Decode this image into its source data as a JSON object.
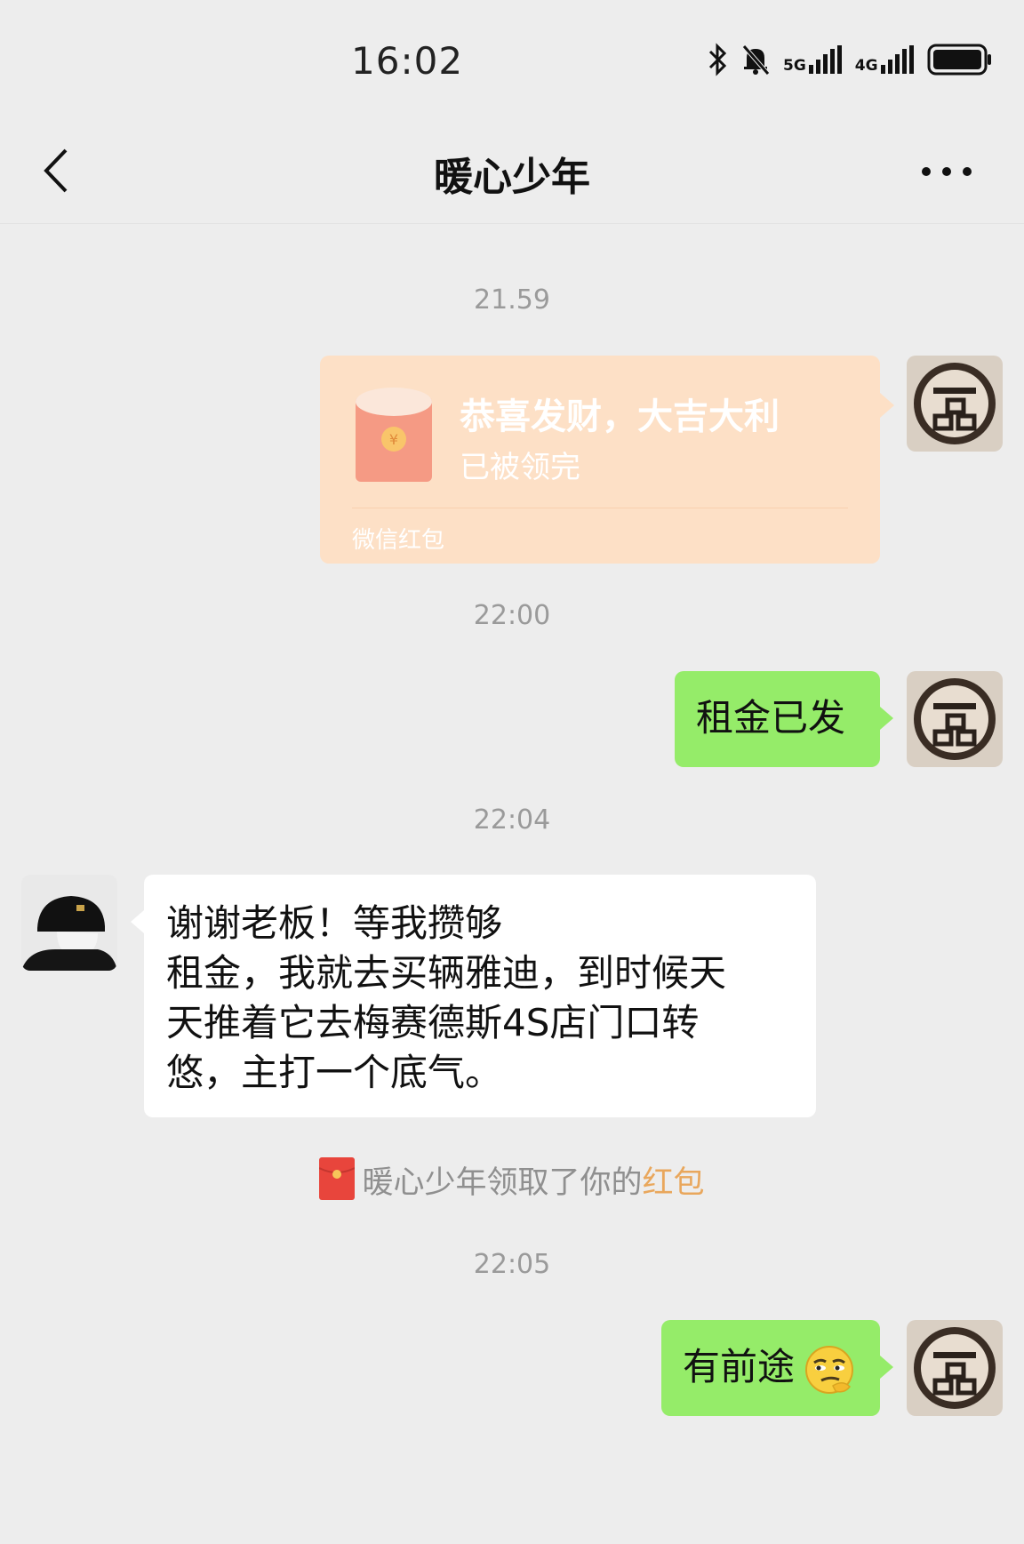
{
  "status_bar": {
    "time": "16:02",
    "network_1": "5G",
    "network_2": "4G",
    "icons": [
      "bluetooth-icon",
      "silent-bell-icon",
      "signal-icon",
      "battery-icon"
    ]
  },
  "nav": {
    "title": "暖心少年",
    "back_icon": "chevron-left-icon",
    "more_icon": "more-dots-icon"
  },
  "messages": {
    "ts1": "21.59",
    "red_packet": {
      "title": "恭喜发财，大吉大利",
      "status": "已被领完",
      "label": "微信红包"
    },
    "ts2": "22:00",
    "msg1": "租金已发",
    "ts3": "22:04",
    "msg2_lines": [
      "谢谢老板！等我攒够",
      "租金，我就去买辆雅迪，到时候天",
      "天推着它去梅赛德斯4S店门口转",
      "悠，主打一个底气。"
    ],
    "system": {
      "prefix": "暖心少年领取了你的",
      "link": "红包"
    },
    "ts4": "22:05",
    "msg3": "有前途",
    "msg3_emoji": "smirk-emoji-icon"
  },
  "colors": {
    "background": "#ededed",
    "green_bubble": "#95ec69",
    "red_packet_bg": "#fde0c6",
    "link": "#e9a75c"
  }
}
